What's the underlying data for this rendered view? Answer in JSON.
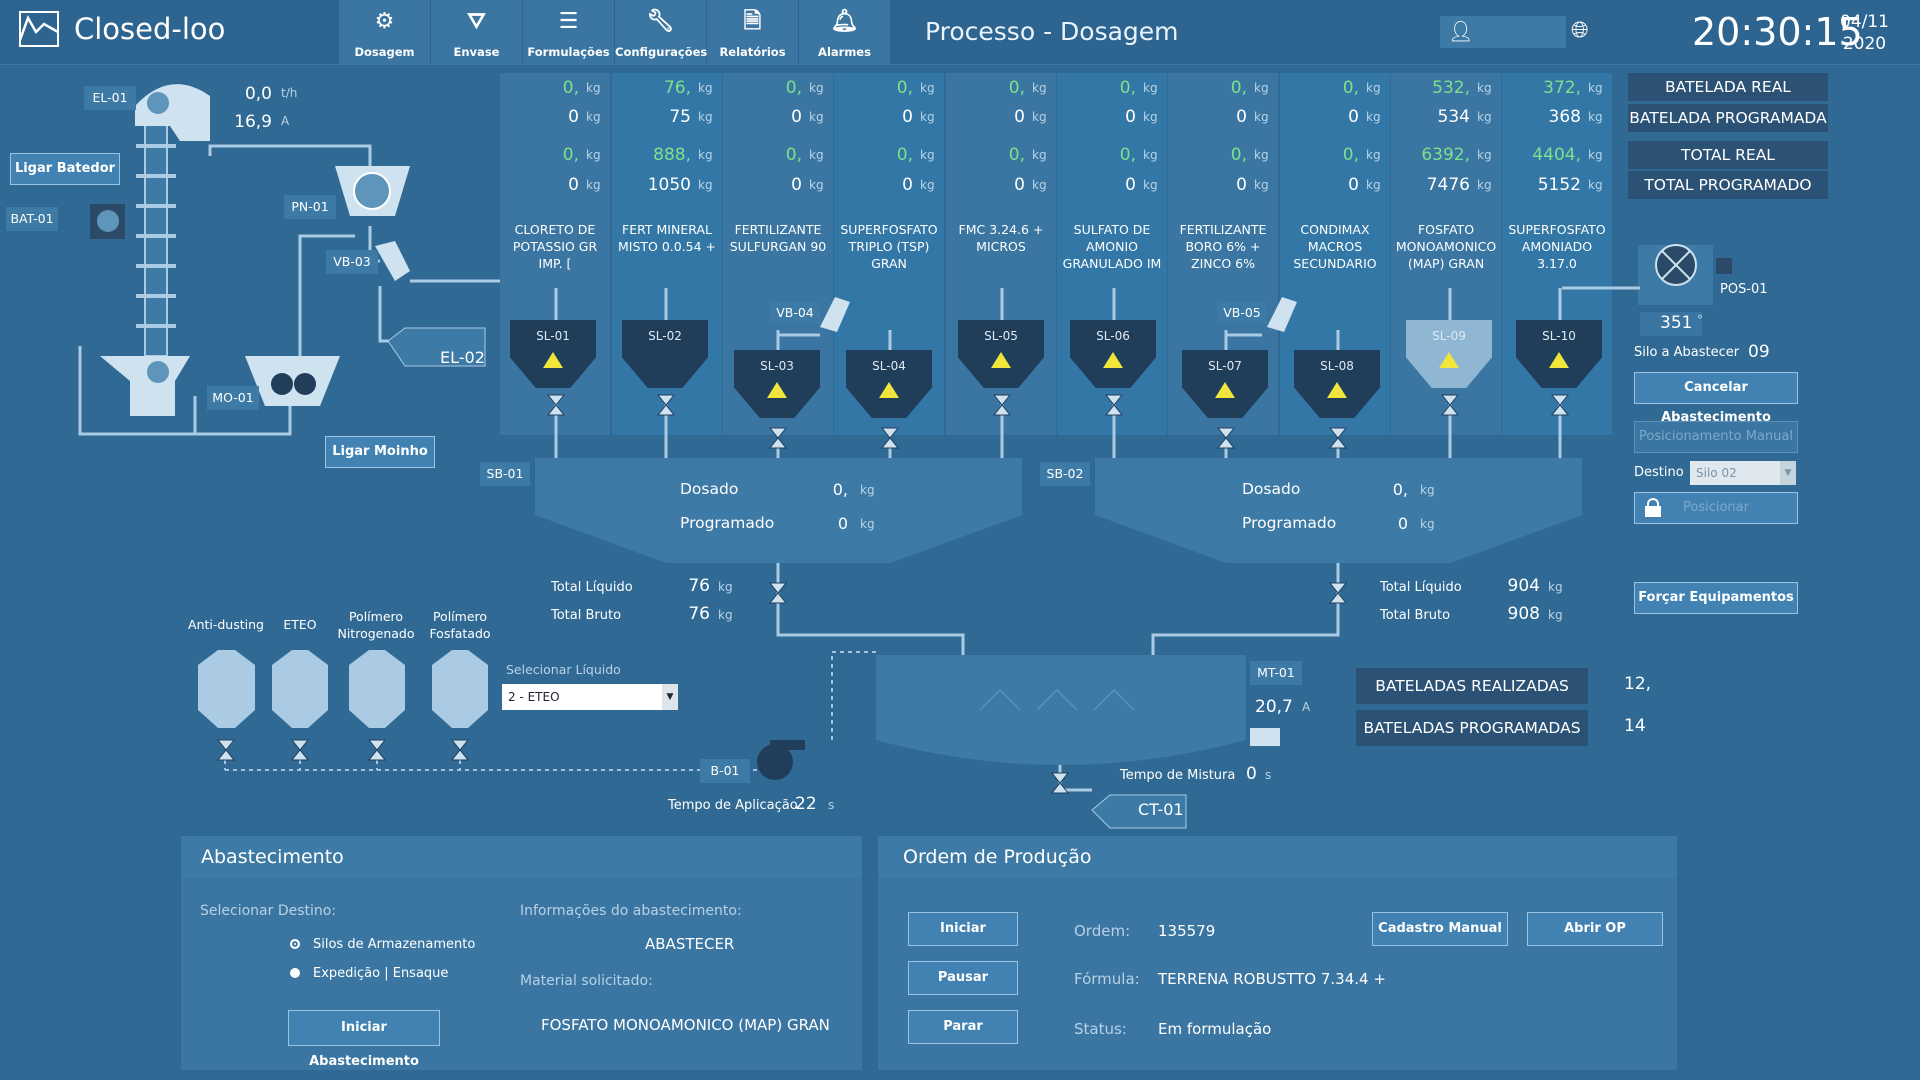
{
  "header": {
    "app_name": "Closed-loo",
    "page_title": "Processo - Dosagem",
    "time": "20:30:15",
    "date_day": "04/11",
    "date_year": "2020",
    "nav": [
      {
        "label": "Dosagem",
        "icon": "gear-icon"
      },
      {
        "label": "Envase",
        "icon": "filter-icon"
      },
      {
        "label": "Formulações",
        "icon": "menu-icon"
      },
      {
        "label": "Configurações",
        "icon": "wrench-icon"
      },
      {
        "label": "Relatórios",
        "icon": "document-icon"
      },
      {
        "label": "Alarmes",
        "icon": "bell-icon"
      }
    ]
  },
  "materials": [
    {
      "name": "CLORETO DE POTASSIO GR IMP. [",
      "bat_real": "0,",
      "bat_prog": "0",
      "tot_real": "0,",
      "tot_prog": "0",
      "silo": "SL-01"
    },
    {
      "name": "FERT MINERAL MISTO 0.0.54 +",
      "bat_real": "76,",
      "bat_prog": "75",
      "tot_real": "888,",
      "tot_prog": "1050",
      "silo": "SL-02"
    },
    {
      "name": "FERTILIZANTE SULFURGAN 90",
      "bat_real": "0,",
      "bat_prog": "0",
      "tot_real": "0,",
      "tot_prog": "0",
      "silo": "SL-03"
    },
    {
      "name": "SUPERFOSFATO TRIPLO (TSP) GRAN",
      "bat_real": "0,",
      "bat_prog": "0",
      "tot_real": "0,",
      "tot_prog": "0",
      "silo": "SL-04"
    },
    {
      "name": "FMC 3.24.6 + MICROS",
      "bat_real": "0,",
      "bat_prog": "0",
      "tot_real": "0,",
      "tot_prog": "0",
      "silo": "SL-05"
    },
    {
      "name": "SULFATO DE AMONIO GRANULADO IM",
      "bat_real": "0,",
      "bat_prog": "0",
      "tot_real": "0,",
      "tot_prog": "0",
      "silo": "SL-06"
    },
    {
      "name": "FERTILIZANTE BORO 6% + ZINCO 6%",
      "bat_real": "0,",
      "bat_prog": "0",
      "tot_real": "0,",
      "tot_prog": "0",
      "silo": "SL-07"
    },
    {
      "name": "CONDIMAX MACROS SECUNDARIO",
      "bat_real": "0,",
      "bat_prog": "0",
      "tot_real": "0,",
      "tot_prog": "0",
      "silo": "SL-08"
    },
    {
      "name": "FOSFATO MONOAMONICO (MAP) GRAN",
      "bat_real": "532,",
      "bat_prog": "534",
      "tot_real": "6392,",
      "tot_prog": "7476",
      "silo": "SL-09"
    },
    {
      "name": "SUPERFOSFATO AMONIADO 3.17.0",
      "bat_real": "372,",
      "bat_prog": "368",
      "tot_real": "4404,",
      "tot_prog": "5152",
      "silo": "SL-10"
    }
  ],
  "units": {
    "kg": "kg",
    "th": "t/h",
    "a": "A",
    "s": "s",
    "deg": "°"
  },
  "legend": {
    "batelada_real": "BATELADA REAL",
    "batelada_prog": "BATELADA PROGRAMADA",
    "total_real": "TOTAL REAL",
    "total_prog": "TOTAL PROGRAMADO"
  },
  "equipment": {
    "el01": "EL-01",
    "el01_flow": "0,0",
    "el01_current": "16,9",
    "bat01": "BAT-01",
    "pn01": "PN-01",
    "vb03": "VB-03",
    "el02": "EL-02",
    "mo01": "MO-01",
    "vb04": "VB-04",
    "vb05": "VB-05",
    "pos01": "POS-01",
    "pos01_val": "351",
    "sb01": "SB-01",
    "sb02": "SB-02",
    "mt01": "MT-01",
    "mt01_current": "20,7",
    "b01": "B-01",
    "ct01": "CT-01"
  },
  "buttons": {
    "ligar_batedor": "Ligar Batedor",
    "ligar_moinho": "Ligar Moinho",
    "cancelar": "Cancelar Abastecimento",
    "posicionamento": "Posicionamento Manual",
    "posicionar": "Posicionar",
    "forcar": "Forçar Equipamentos"
  },
  "silo_abastecer": {
    "label": "Silo a Abastecer",
    "value": "09",
    "destino_label": "Destino",
    "destino_value": "Silo 02"
  },
  "scales": {
    "dosado": "Dosado",
    "programado": "Programado",
    "sb01_dos": "0,",
    "sb01_prog": "0",
    "sb02_dos": "0,",
    "sb02_prog": "0"
  },
  "totals": {
    "liq_label": "Total Líquido",
    "bruto_label": "Total Bruto",
    "left_liq": "76",
    "left_bruto": "76",
    "right_liq": "904",
    "right_bruto": "908"
  },
  "liquids": {
    "names": [
      "Anti-dusting",
      "ETEO",
      "Polímero Nitrogenado",
      "Polímero Fosfatado"
    ],
    "select_label": "Selecionar Líquido",
    "select_value": "2 - ETEO",
    "tempo_aplic_label": "Tempo de Aplicação",
    "tempo_aplic": "22"
  },
  "mixer": {
    "tempo_mistura_label": "Tempo de Mistura",
    "tempo_mistura": "0"
  },
  "batches": {
    "realizadas_label": "BATELADAS REALIZADAS",
    "realizadas": "12,",
    "programadas_label": "BATELADAS PROGRAMADAS",
    "programadas": "14"
  },
  "abastecimento": {
    "title": "Abastecimento",
    "sel_destino": "Selecionar Destino:",
    "opt1": "Silos de Armazenamento",
    "opt2": "Expedição | Ensaque",
    "info_label": "Informações do abastecimento:",
    "info_value": "ABASTECER",
    "mat_label": "Material solicitado:",
    "mat_value": "FOSFATO MONOAMONICO (MAP) GRAN",
    "btn": "Iniciar Abastecimento"
  },
  "ordem": {
    "title": "Ordem de Produção",
    "iniciar": "Iniciar",
    "pausar": "Pausar",
    "parar": "Parar",
    "ordem_label": "Ordem:",
    "ordem_value": "135579",
    "formula_label": "Fórmula:",
    "formula_value": "TERRENA ROBUSTTO 7.34.4 +",
    "status_label": "Status:",
    "status_value": "Em formulação",
    "cadastro": "Cadastro Manual",
    "abrir": "Abrir OP"
  }
}
